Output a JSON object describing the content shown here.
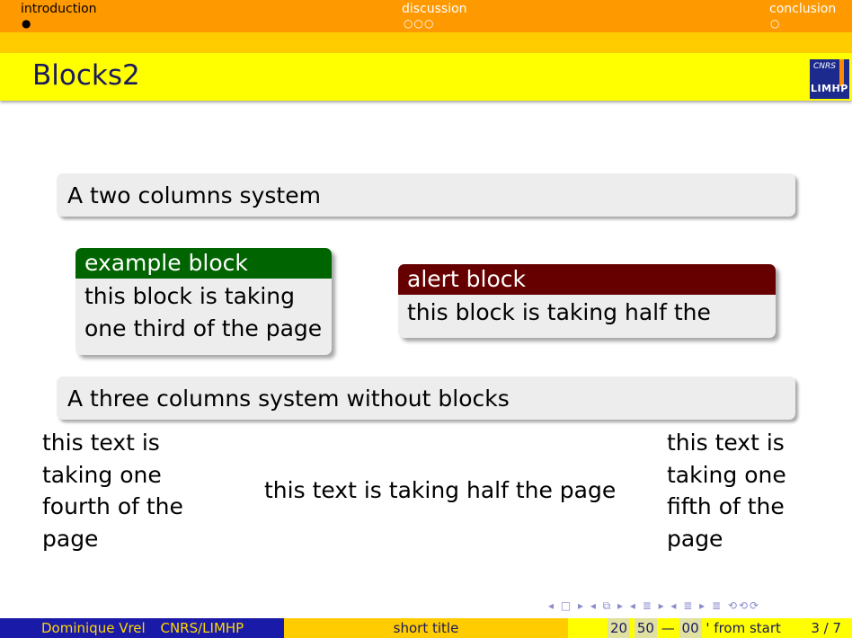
{
  "nav": {
    "sections": [
      {
        "label": "introduction",
        "dots": "●",
        "current": true
      },
      {
        "label": "discussion",
        "dots": "○○○",
        "current": false
      },
      {
        "label": "conclusion",
        "dots": "○",
        "current": false
      }
    ]
  },
  "frame": {
    "title": "Blocks2"
  },
  "logo": {
    "top": "CNRS",
    "bottom": "LIMHP"
  },
  "content": {
    "two_columns_header": "A two columns system",
    "example_block": {
      "title": "example block",
      "line1": "this block is taking",
      "line2": "one third of the page"
    },
    "alert_block": {
      "title": "alert block",
      "body": "this block is taking half the page"
    },
    "three_columns_header": "A three columns system without blocks",
    "col_left": [
      "this text is",
      "taking one",
      "fourth of the",
      "page"
    ],
    "col_mid": "this text is taking half the page",
    "col_right": [
      "this text is",
      "taking one",
      "fifth of the",
      "page"
    ]
  },
  "beamer_nav": {
    "symbols": "◂ □ ▸ ◂ ⧉ ▸ ◂ ≣ ▸ ◂ ≣ ▸   ≣   ⟲⟲⟳"
  },
  "footer": {
    "author": "Dominique Vrel",
    "institute": "CNRS/LIMHP",
    "short_title": "short title",
    "time_h": "20",
    "time_m": "50",
    "dash": "—",
    "time_s": "00",
    "from_start": "' from start",
    "page": "3 / 7"
  },
  "colors": {
    "nav_orange": "#ff9900",
    "nav_amber": "#ffcc00",
    "title_yellow": "#ffff00",
    "example_green": "#006400",
    "alert_red": "#660000",
    "footer_blue": "#1a1aa8"
  }
}
